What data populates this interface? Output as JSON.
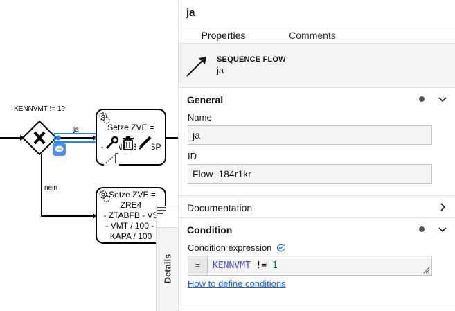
{
  "canvas": {
    "gateway_label": "KENNVMT != 1?",
    "flow_yes_label": "ja",
    "flow_no_label": "nein",
    "task1": {
      "line1": "Setze ZVE =",
      "partial_line": "- ZTABFB - VSP",
      "partial_line2": "- VMT / 100 -"
    },
    "task2": {
      "line1": "Setze ZVE =",
      "line2": "ZRE4",
      "line3": "- ZTABFB - VSP",
      "line4": "- VMT / 100 - V",
      "line5": "KAPA / 100"
    },
    "details_tab_label": "Details"
  },
  "panel": {
    "title": "ja",
    "tabs": [
      "Properties",
      "Comments"
    ],
    "active_tab": "Properties",
    "element_type": "SEQUENCE FLOW",
    "element_name": "ja",
    "groups": {
      "general": {
        "title": "General",
        "name_label": "Name",
        "name_value": "ja",
        "id_label": "ID",
        "id_value": "Flow_184r1kr"
      },
      "documentation": {
        "title": "Documentation"
      },
      "condition": {
        "title": "Condition",
        "expr_label": "Condition expression",
        "expr_prefix": "=",
        "expr_keyword": "KENNVMT",
        "expr_operator": "!=",
        "expr_number": "1",
        "help_link": "How to define conditions"
      }
    }
  },
  "colors": {
    "selection_blue": "#1f88e5",
    "link_blue": "#0f62fe",
    "header_gray": "#f4f4f4",
    "keyword_color": "#4e4ed8",
    "number_color": "#1e7b3a"
  }
}
